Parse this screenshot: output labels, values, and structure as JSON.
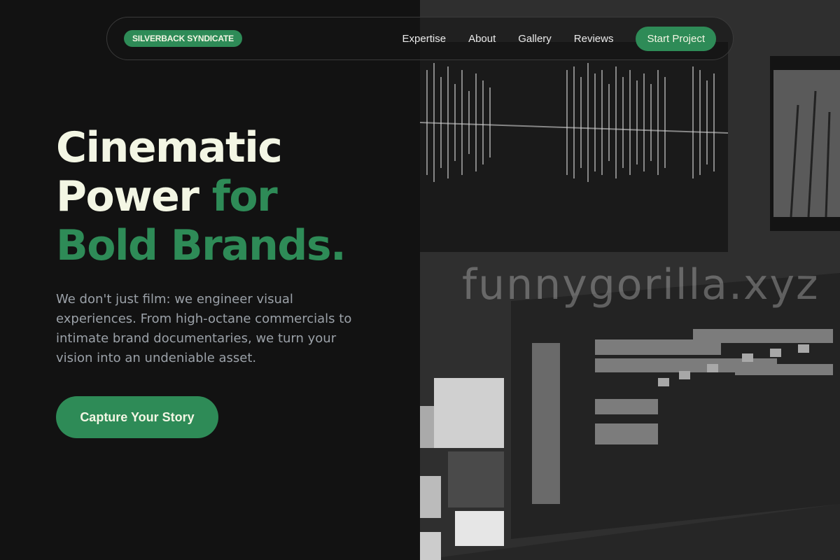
{
  "nav": {
    "brand": "SILVERBACK SYNDICATE",
    "links": [
      "Expertise",
      "About",
      "Gallery",
      "Reviews"
    ],
    "cta": "Start Project"
  },
  "hero": {
    "title_line1": "Cinematic",
    "title_line2_plain": "Power ",
    "title_line2_accent": "for",
    "title_line3_accent": "Bold Brands.",
    "description": "We don't just film: we engineer visual experiences. From high-octane commercials to intimate brand documentaries, we turn your vision into an undeniable asset.",
    "cta": "Capture Your Story"
  },
  "watermark": "funnygorilla.xyz",
  "colors": {
    "accent": "#2e8b57",
    "title": "#f3f6e4",
    "background": "#121212",
    "body_text": "#9ba1a8"
  },
  "image": {
    "subject": "video-editing-timeline-monitor"
  }
}
